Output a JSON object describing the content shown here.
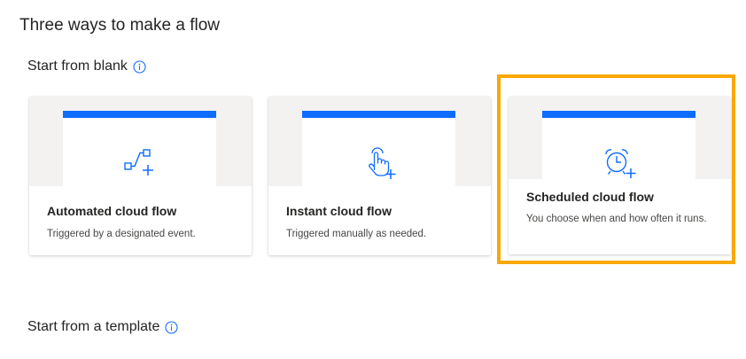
{
  "page": {
    "title": "Three ways to make a flow"
  },
  "sections": {
    "blank": {
      "heading": "Start from blank",
      "info_icon": "info-icon"
    },
    "template": {
      "heading": "Start from a template",
      "info_icon": "info-icon"
    }
  },
  "cards": [
    {
      "title": "Automated cloud flow",
      "description": "Triggered by a designated event.",
      "icon": "automated-flow-icon"
    },
    {
      "title": "Instant cloud flow",
      "description": "Triggered manually as needed.",
      "icon": "touch-hand-icon"
    },
    {
      "title": "Scheduled cloud flow",
      "description": "You choose when and how often it runs.",
      "icon": "alarm-clock-icon",
      "highlighted": true
    }
  ],
  "colors": {
    "accent": "#0f6cff",
    "highlight": "#f9a800",
    "illustration_bg": "#f3f2f1",
    "text": "#252423"
  }
}
